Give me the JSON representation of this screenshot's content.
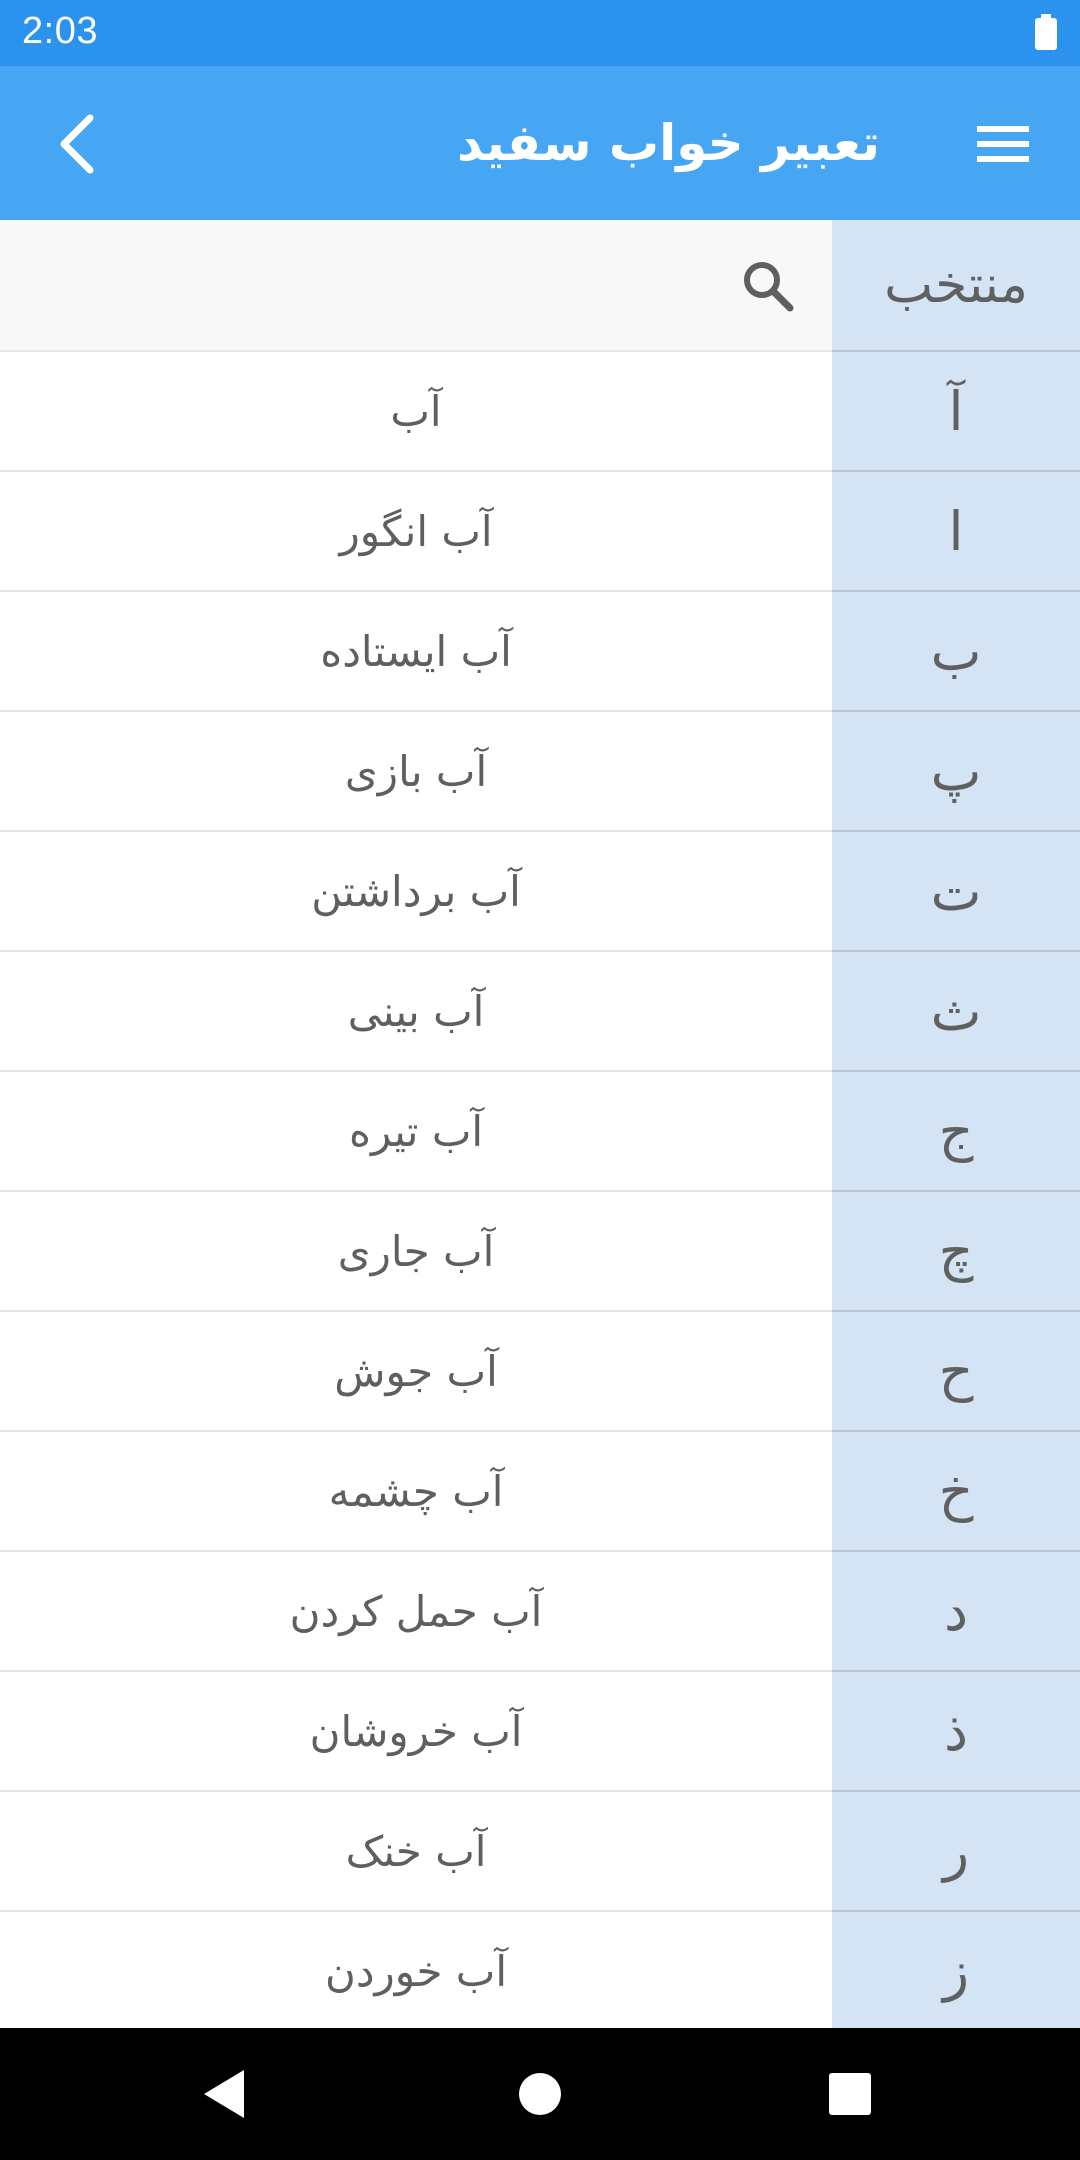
{
  "status_bar": {
    "time": "2:03",
    "battery_icon": "battery-full-icon"
  },
  "app_bar": {
    "title": "تعبیر خواب سفید",
    "back_icon": "chevron-left-icon",
    "menu_icon": "hamburger-menu-icon",
    "background": "#46a6f3"
  },
  "search": {
    "icon": "search-icon"
  },
  "sidebar": {
    "header": "منتخب",
    "letters": [
      "آ",
      "ا",
      "ب",
      "پ",
      "ت",
      "ث",
      "ج",
      "چ",
      "ح",
      "خ",
      "د",
      "ذ",
      "ر",
      "ز"
    ]
  },
  "list": {
    "items": [
      "آب",
      "آب انگور",
      "آب ایستاده",
      "آب بازی",
      "آب برداشتن",
      "آب بینی",
      "آب تیره",
      "آب جاری",
      "آب جوش",
      "آب چشمه",
      "آب حمل کردن",
      "آب خروشان",
      "آب خنک",
      "آب خوردن"
    ]
  },
  "nav_bar": {
    "back_icon": "triangle-back-icon",
    "home_icon": "circle-home-icon",
    "recents_icon": "square-recents-icon"
  }
}
